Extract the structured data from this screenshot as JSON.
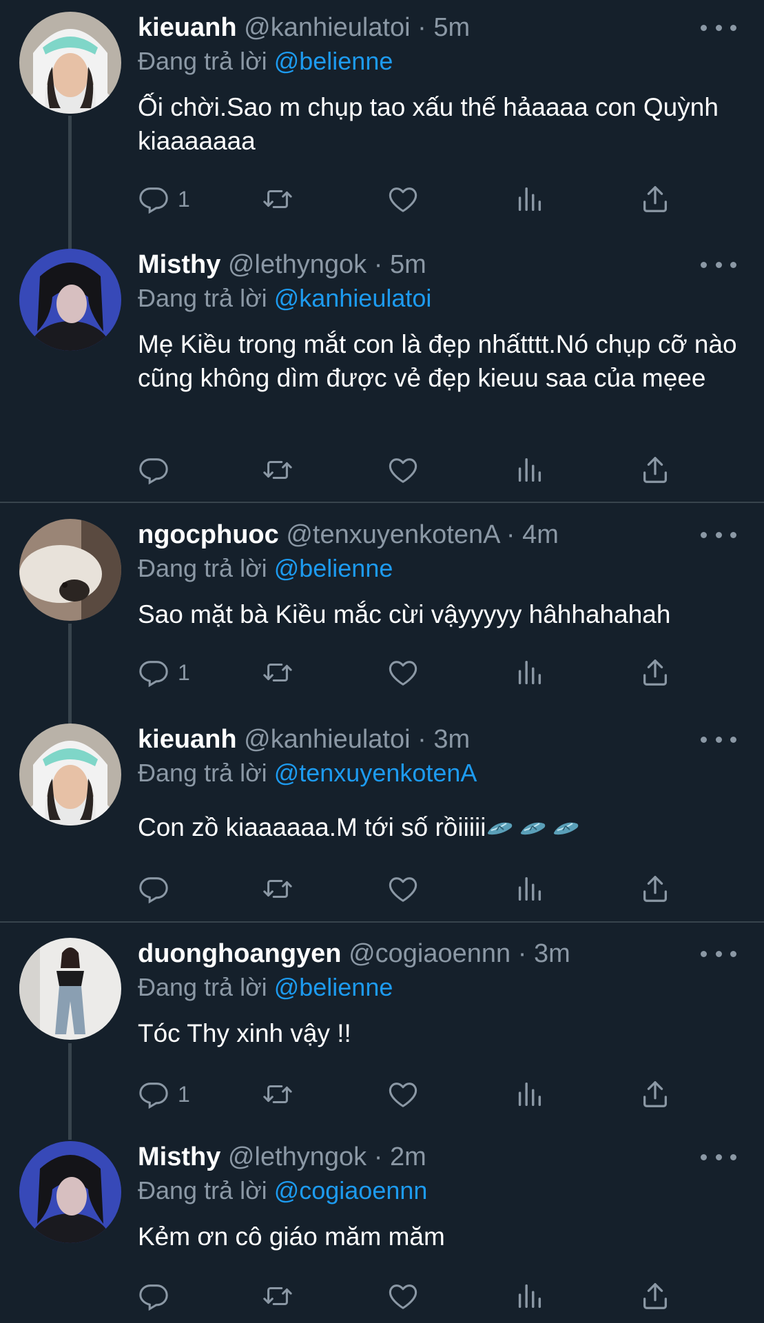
{
  "reply_prefix": "Đang trả lời",
  "tweets": [
    {
      "name": "kieuanh",
      "handle": "@kanhieulatoi",
      "sep": "·",
      "time": "5m",
      "reply_to": "@belienne",
      "text": "Ối chời.Sao m chụp tao xấu thế hảaaaa con Quỳnh kiaaaaaaa",
      "reply_count": "1"
    },
    {
      "name": "Misthy",
      "handle": "@lethyngok",
      "sep": "·",
      "time": "5m",
      "reply_to": "@kanhieulatoi",
      "text": "Mẹ Kiều trong mắt con là đẹp nhấtttt.Nó chụp cỡ nào cũng không dìm được vẻ đẹp kieuu saa của mẹee",
      "reply_count": ""
    },
    {
      "name": "ngocphuoc",
      "handle": "@tenxuyenkotenA",
      "sep": "·",
      "time": "4m",
      "reply_to": "@belienne",
      "text": "Sao mặt bà Kiều mắc cừi vậyyyyy hâhhahahah",
      "reply_count": "1"
    },
    {
      "name": "kieuanh",
      "handle": "@kanhieulatoi",
      "sep": "·",
      "time": "3m",
      "reply_to": "@tenxuyenkotenA",
      "text": "Con zồ kiaaaaaa.M tới số rồiiiii",
      "reply_count": ""
    },
    {
      "name": "duonghoangyen",
      "handle": "@cogiaoennn",
      "sep": "·",
      "time": "3m",
      "reply_to": "@belienne",
      "text": "Tóc Thy xinh vậy !!",
      "reply_count": "1"
    },
    {
      "name": "Misthy",
      "handle": "@lethyngok",
      "sep": "·",
      "time": "2m",
      "reply_to": "@cogiaoennn",
      "text": "Kẻm ơn cô giáo măm măm",
      "reply_count": ""
    }
  ],
  "icons": {
    "reply": "reply-icon",
    "retweet": "retweet-icon",
    "like": "heart-icon",
    "stats": "analytics-icon",
    "share": "share-icon",
    "more": "more-icon",
    "emoji": "flip-flop-emoji"
  },
  "colors": {
    "background": "#15202b",
    "muted": "#8b98a5",
    "mention": "#1d9bf0",
    "divider": "#38444d"
  }
}
